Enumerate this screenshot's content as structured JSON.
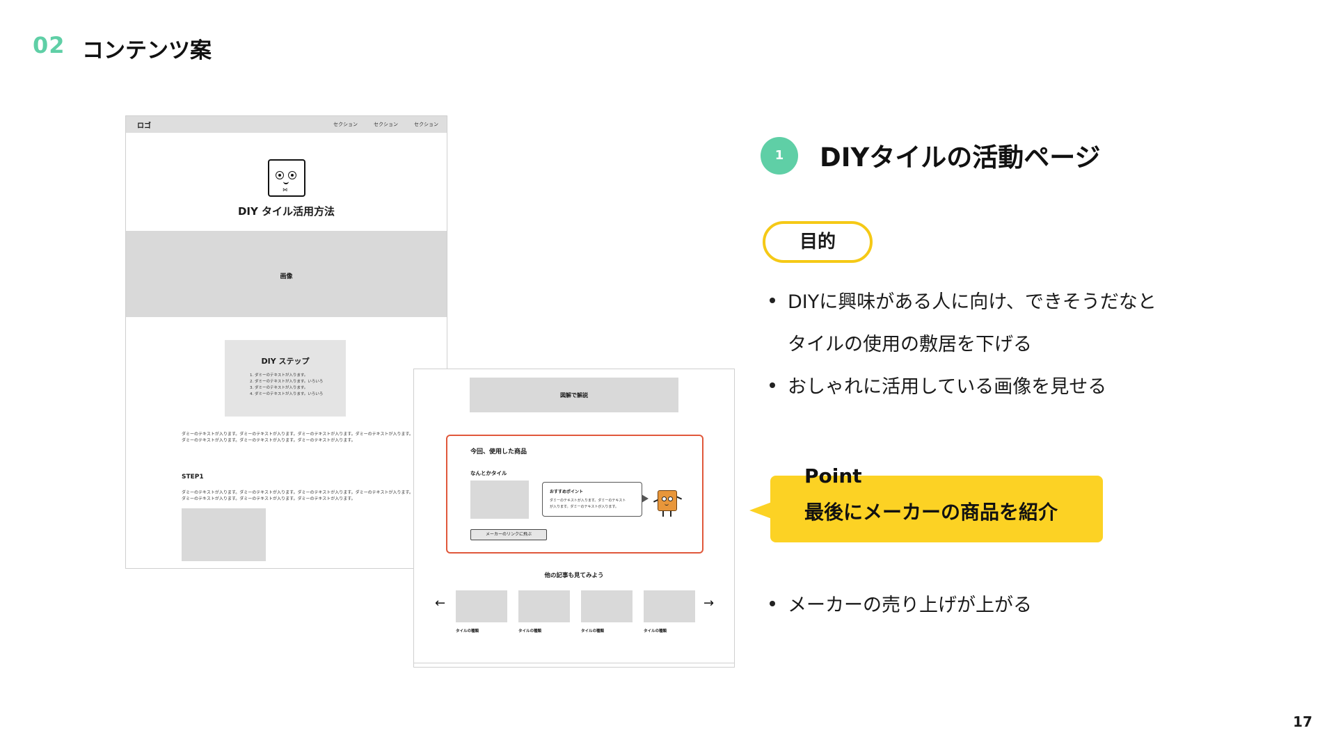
{
  "header": {
    "section_number": "02",
    "section_title": "コンテンツ案"
  },
  "page_number": "17",
  "wireframe_top": {
    "nav": {
      "logo": "ロゴ",
      "items": [
        "セクション",
        "セクション",
        "セクション"
      ]
    },
    "mascot_icon": "box-face-icon",
    "title": "DIY タイル活用方法",
    "hero_label": "画像",
    "step_box": {
      "title": "DIY ステップ",
      "lines": [
        "1. ダミーのテキストが入ります。",
        "2. ダミーのテキストが入ります。いろいろ",
        "3. ダミーのテキストが入ります。",
        "4. ダミーのテキストが入ります。いろいろ"
      ]
    },
    "intro_lines": [
      "ダミーのテキストが入ります。ダミーのテキストが入ります。ダミーのテキストが入ります。ダミーのテキストが入ります。",
      "ダミーのテキストが入ります。ダミーのテキストが入ります。ダミーのテキストが入ります。"
    ],
    "step1_heading": "STEP1",
    "step1_lines": [
      "ダミーのテキストが入ります。ダミーのテキストが入ります。ダミーのテキストが入ります。ダミーのテキストが入ります。",
      "ダミーのテキストが入ります。ダミーのテキストが入ります。ダミーのテキストが入ります。"
    ]
  },
  "wireframe_bottom": {
    "banner_label": "図解で解説",
    "product": {
      "title": "今回、使用した商品",
      "name": "なんとかタイル",
      "bubble_title": "おすすめポイント",
      "bubble_lines": [
        "ダミーのテキストが入ります。ダミーのテキスト",
        "が入ります。ダミーのテキストが入ります。"
      ],
      "link_label": "メーカーのリンクに飛ぶ",
      "character_icon": "tile-character-icon"
    },
    "other_heading": "他の記事も見てみよう",
    "prev_arrow": "←",
    "next_arrow": "→",
    "cards": [
      "タイルの種類",
      "タイルの種類",
      "タイルの種類",
      "タイルの種類"
    ]
  },
  "right": {
    "item_number": "1",
    "heading": "DIYタイルの活動ページ",
    "purpose_label": "目的",
    "purpose_bullets": [
      [
        "DIYに興味がある人に向け、できそうだなと",
        "タイルの使用の敷居を下げる"
      ],
      [
        "おしゃれに活用している画像を見せる"
      ]
    ],
    "point": {
      "label": "Point",
      "text": "最後にメーカーの商品を紹介"
    },
    "result_bullet": "メーカーの売り上げが上がる"
  },
  "colors": {
    "accent_green": "#5fcfa6",
    "highlight_yellow": "#fcd224",
    "pill_border": "#f5c916",
    "product_border": "#e0573a"
  }
}
